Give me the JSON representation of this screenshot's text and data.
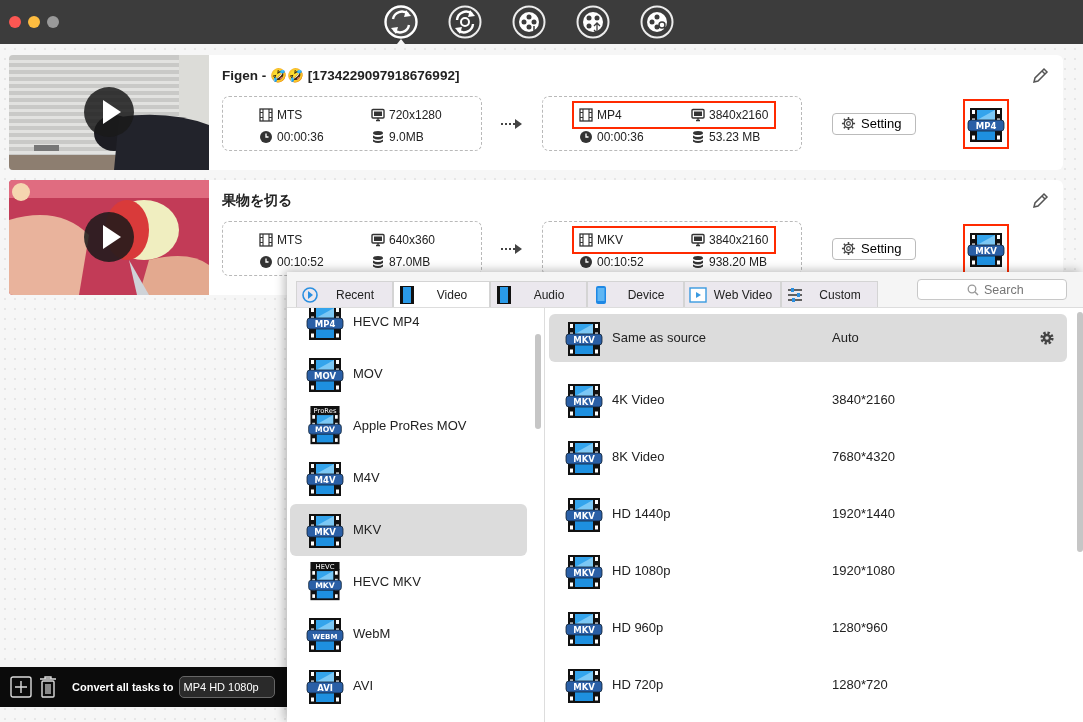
{
  "window": {
    "controls": [
      {
        "kind": "close",
        "enabled": true
      },
      {
        "kind": "minimize",
        "enabled": true
      },
      {
        "kind": "zoom",
        "enabled": false
      }
    ]
  },
  "toolbar": [
    {
      "kind": "convert",
      "selected": true
    },
    {
      "kind": "rotate",
      "selected": false
    },
    {
      "kind": "film-download",
      "selected": false
    },
    {
      "kind": "film-compress",
      "selected": false
    },
    {
      "kind": "film-search",
      "selected": false
    }
  ],
  "tasks": [
    {
      "title": "Figen - 🤣🤣 [1734229097918676992]",
      "source": {
        "format": "MTS",
        "resolution": "720x1280",
        "duration": "00:00:36",
        "size": "9.0MB"
      },
      "target": {
        "format": "MP4",
        "resolution": "3840x2160",
        "duration": "00:00:36",
        "size": "53.23 MB",
        "highlighted": true
      },
      "setting": "Setting",
      "format_badge": "MP4"
    },
    {
      "title": "果物を切る",
      "source": {
        "format": "MTS",
        "resolution": "640x360",
        "duration": "00:10:52",
        "size": "87.0MB"
      },
      "target": {
        "format": "MKV",
        "resolution": "3840x2160",
        "duration": "00:10:52",
        "size": "938.20 MB",
        "highlighted": true
      },
      "setting": "Setting",
      "format_badge": "MKV"
    }
  ],
  "bottom_bar": {
    "label": "Convert all tasks to",
    "value": "MP4 HD 1080p"
  },
  "format_picker": {
    "tabs": [
      {
        "kind": "recent",
        "label": "Recent",
        "selected": false
      },
      {
        "kind": "video",
        "label": "Video",
        "selected": true
      },
      {
        "kind": "audio",
        "label": "Audio",
        "selected": false
      },
      {
        "kind": "device",
        "label": "Device",
        "selected": false
      },
      {
        "kind": "web",
        "label": "Web Video",
        "selected": false
      },
      {
        "kind": "custom",
        "label": "Custom",
        "selected": false
      }
    ],
    "search": {
      "placeholder": "Search"
    },
    "formats": [
      {
        "label": "HEVC MP4",
        "badge": "MP4",
        "selected": false
      },
      {
        "label": "MOV",
        "badge": "MOV",
        "selected": false
      },
      {
        "label": "Apple ProRes MOV",
        "badge": "MOV",
        "badge_top": "ProRes",
        "selected": false
      },
      {
        "label": "M4V",
        "badge": "M4V",
        "selected": false
      },
      {
        "label": "MKV",
        "badge": "MKV",
        "selected": true
      },
      {
        "label": "HEVC MKV",
        "badge": "MKV",
        "badge_top": "HEVC",
        "selected": false
      },
      {
        "label": "WebM",
        "badge": "WEBM",
        "selected": false
      },
      {
        "label": "AVI",
        "badge": "AVI",
        "selected": false
      }
    ],
    "presets": [
      {
        "name": "Same as source",
        "resolution": "Auto",
        "badge": "MKV",
        "selected": true
      },
      {
        "name": "4K Video",
        "resolution": "3840*2160",
        "badge": "MKV",
        "selected": false
      },
      {
        "name": "8K Video",
        "resolution": "7680*4320",
        "badge": "MKV",
        "selected": false
      },
      {
        "name": "HD 1440p",
        "resolution": "1920*1440",
        "badge": "MKV",
        "selected": false
      },
      {
        "name": "HD 1080p",
        "resolution": "1920*1080",
        "badge": "MKV",
        "selected": false
      },
      {
        "name": "HD 960p",
        "resolution": "1280*960",
        "badge": "MKV",
        "selected": false
      },
      {
        "name": "HD 720p",
        "resolution": "1280*720",
        "badge": "MKV",
        "selected": false
      }
    ]
  }
}
